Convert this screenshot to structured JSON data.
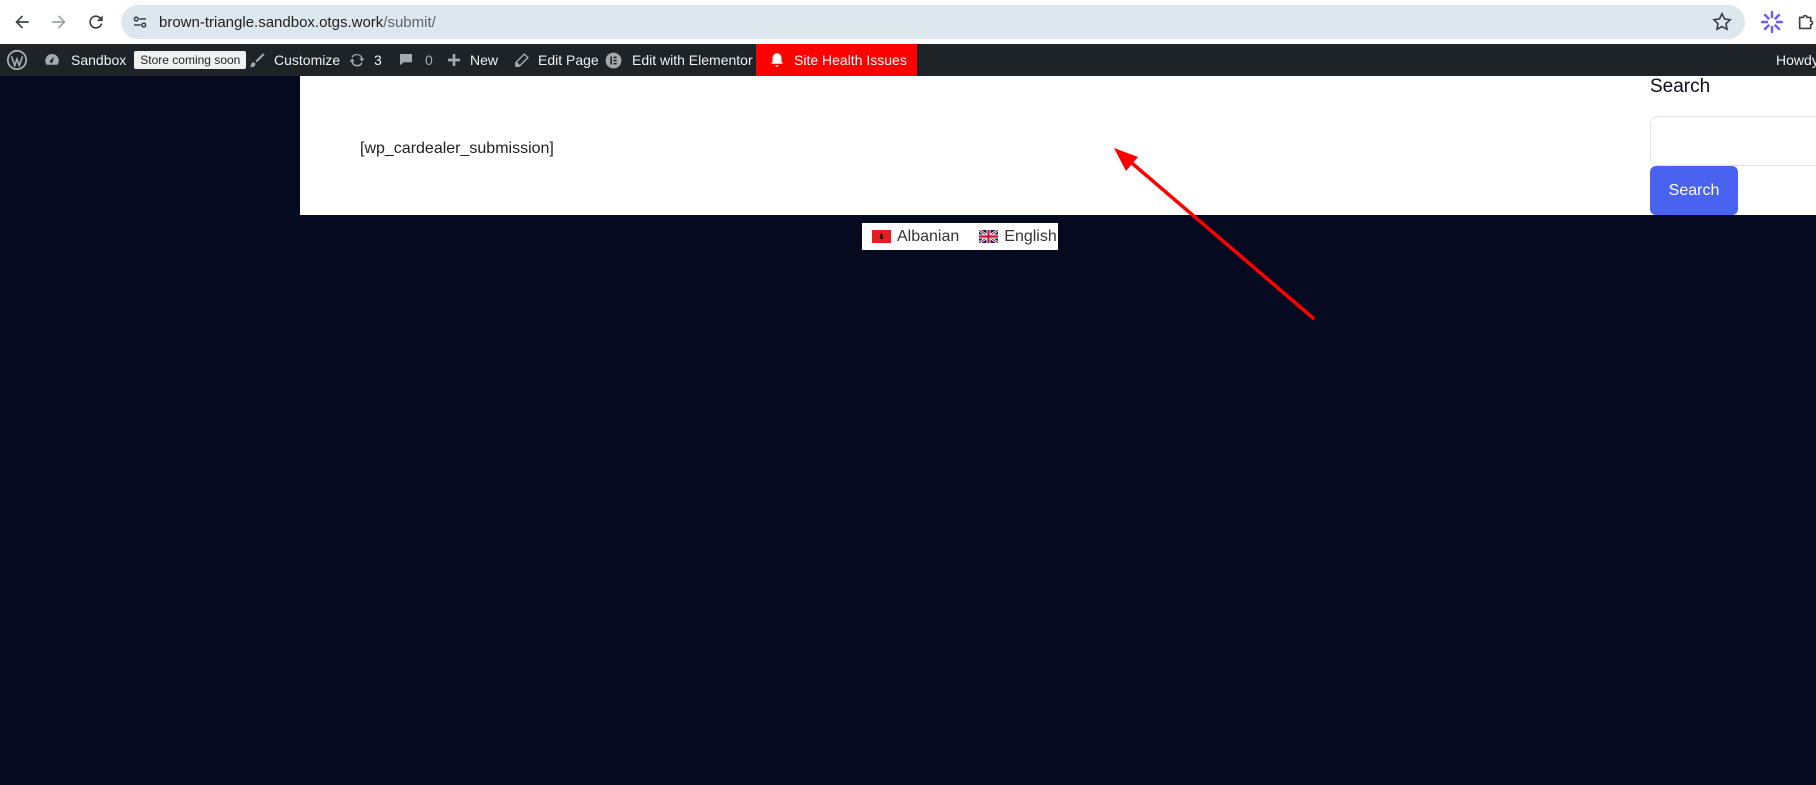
{
  "browser": {
    "url_host": "brown-triangle.sandbox.otgs.work",
    "url_path": "/submit/"
  },
  "adminbar": {
    "site_name": "Sandbox",
    "store_badge": "Store coming soon",
    "customize": "Customize",
    "updates_count": "3",
    "comments_count": "0",
    "new": "New",
    "edit_page": "Edit Page",
    "edit_elementor": "Edit with Elementor",
    "site_health": "Site Health Issues",
    "howdy": "Howdy"
  },
  "page": {
    "shortcode": "[wp_cardealer_submission]",
    "search_title": "Search",
    "search_button": "Search"
  },
  "languages": [
    {
      "label": "Albanian",
      "flag": "albania-flag-icon"
    },
    {
      "label": "English",
      "flag": "uk-flag-icon"
    }
  ],
  "colors": {
    "page_background": "#050a20",
    "adminbar": "#1d2327",
    "site_health_bg": "#ff0000",
    "search_button": "#4a62f0",
    "annotation_arrow": "#ff0000"
  }
}
